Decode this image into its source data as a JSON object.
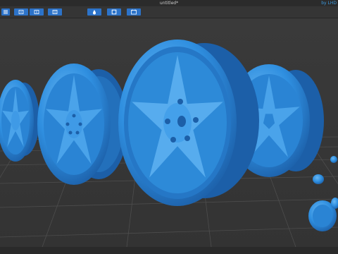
{
  "window": {
    "title": "untitled*",
    "brand_text": "by LHD"
  },
  "toolbar": {
    "buttons": [
      {
        "icon": "menu-icon"
      },
      {
        "icon": "import-icon"
      },
      {
        "icon": "export-icon"
      },
      {
        "icon": "settings-icon"
      },
      {
        "icon": "paint-drop-icon"
      },
      {
        "icon": "frame-icon"
      },
      {
        "icon": "calendar-icon"
      }
    ]
  },
  "colors": {
    "model": "#2f8fe0",
    "model_dark": "#1c5fa8",
    "model_light": "#6bb8f2",
    "grid": "#4d4d4d",
    "background": "#3a3a3a"
  },
  "scene": {
    "objects": [
      "wheel-rim",
      "wheel-rim",
      "wheel-rim",
      "wheel-rim",
      "wheel-rim",
      "lug-caps"
    ]
  }
}
